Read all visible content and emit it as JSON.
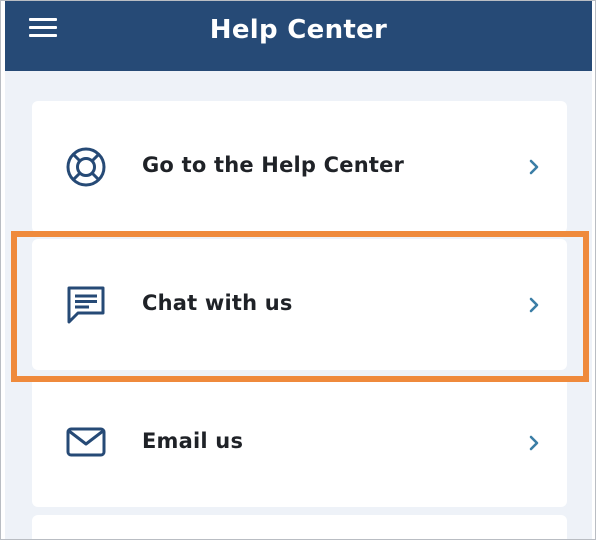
{
  "header": {
    "title": "Help Center",
    "menu_icon": "hamburger-menu-icon",
    "background_color": "#264a76"
  },
  "menu_items": [
    {
      "label": "Go to the Help Center",
      "icon": "lifebuoy-icon",
      "chevron_icon": "chevron-right-icon"
    },
    {
      "label": "Chat with us",
      "icon": "chat-bubble-icon",
      "chevron_icon": "chevron-right-icon"
    },
    {
      "label": "Email us",
      "icon": "envelope-icon",
      "chevron_icon": "chevron-right-icon"
    }
  ],
  "colors": {
    "icon": "#264a76",
    "chevron": "#3b7ea6",
    "highlight": "#ef8a3c",
    "page_background": "#eef2f8"
  },
  "highlighted_item": "Chat with us"
}
